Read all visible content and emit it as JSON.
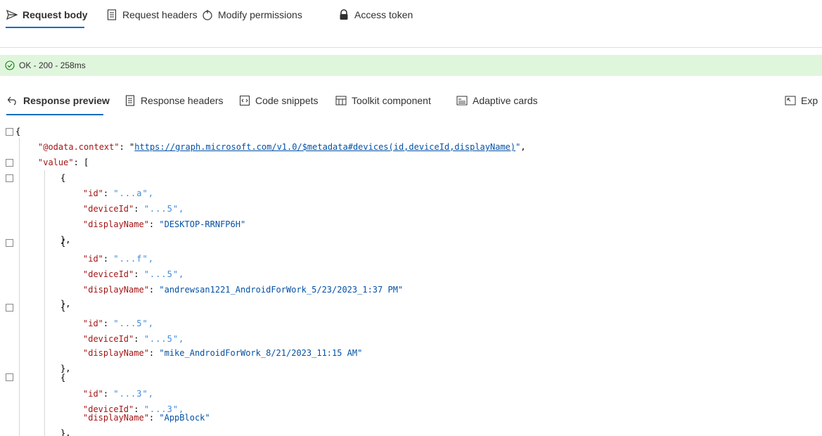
{
  "request_tabs": [
    {
      "label": "Request body",
      "icon": "send-icon",
      "active": true
    },
    {
      "label": "Request headers",
      "icon": "document-icon",
      "active": false
    },
    {
      "label": "Modify permissions",
      "icon": "permissions-icon",
      "active": false
    },
    {
      "label": "Access token",
      "icon": "lock-icon",
      "active": false
    }
  ],
  "status": {
    "text": "OK - 200 - 258ms",
    "color": "#dff6dd",
    "icon": "check-circle-icon"
  },
  "response_tabs": [
    {
      "label": "Response preview",
      "icon": "preview-icon",
      "active": true
    },
    {
      "label": "Response headers",
      "icon": "document-icon",
      "active": false
    },
    {
      "label": "Code snippets",
      "icon": "code-icon",
      "active": false
    },
    {
      "label": "Toolkit component",
      "icon": "toolkit-icon",
      "active": false
    },
    {
      "label": "Adaptive cards",
      "icon": "card-icon",
      "active": false
    },
    {
      "label": "Exp",
      "icon": "expand-icon",
      "active": false
    }
  ],
  "json": {
    "open_brace": "{",
    "context_key": "\"@odata.context\"",
    "context_url": "https://graph.microsoft.com/v1.0/$metadata#devices(id,deviceId,displayName)",
    "value_key": "\"value\"",
    "devices": [
      {
        "id_partial": "\"...a\",",
        "deviceId_partial": "\"...5\",",
        "displayName": "\"DESKTOP-RRNFP6H\""
      },
      {
        "id_partial": "\"...f\",",
        "deviceId_partial": "\"...5\",",
        "displayName": "\"andrewsan1221_AndroidForWork_5/23/2023_1:37 PM\""
      },
      {
        "id_partial": "\"...5\",",
        "deviceId_partial": "\"...5\",",
        "displayName": "\"mike_AndroidForWork_8/21/2023_11:15 AM\""
      },
      {
        "id_partial": "\"...3\",",
        "deviceId_partial": "\"...3\",",
        "displayName": "\"AppBlock\""
      }
    ]
  }
}
